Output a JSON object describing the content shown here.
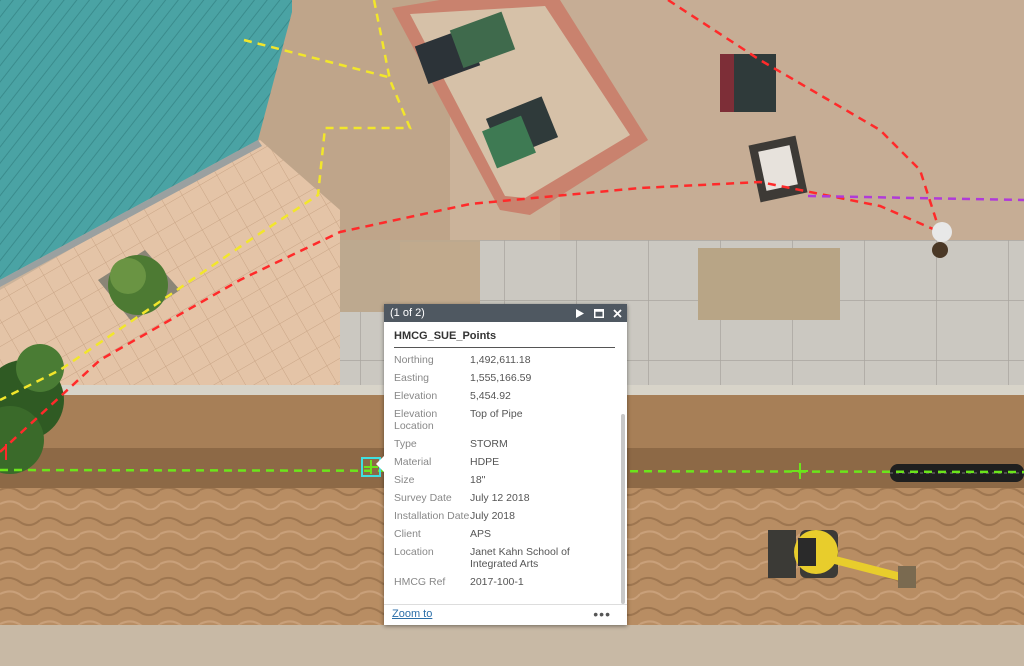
{
  "map": {
    "colors": {
      "roof": "#4aa3a4",
      "soil": "#b48a62",
      "sidewalk": "#c9c5bd",
      "tile_plaza": "#e3c2a4",
      "utility_red": "#ff2a2a",
      "utility_yellow": "#f2e62b",
      "utility_green": "#6be51b",
      "utility_purple": "#b03bd8"
    },
    "icons": [
      "excavator-icon",
      "dumpster-icon",
      "selected-point-marker",
      "survey-point-marker"
    ]
  },
  "popup": {
    "counter": "(1 of 2)",
    "title": "HMCG_SUE_Points",
    "attributes": [
      {
        "key": "Northing",
        "value": "1,492,611.18"
      },
      {
        "key": "Easting",
        "value": "1,555,166.59"
      },
      {
        "key": "Elevation",
        "value": "5,454.92"
      },
      {
        "key": "Elevation Location",
        "value": "Top of Pipe"
      },
      {
        "key": "Type",
        "value": "STORM"
      },
      {
        "key": "Material",
        "value": "HDPE"
      },
      {
        "key": "Size",
        "value": "18\""
      },
      {
        "key": "Survey Date",
        "value": "July 12 2018"
      },
      {
        "key": "Installation Date",
        "value": "July 2018"
      },
      {
        "key": "Client",
        "value": "APS"
      },
      {
        "key": "Location",
        "value": "Janet Kahn School of Integrated Arts"
      },
      {
        "key": "HMCG Ref",
        "value": "2017-100-1"
      }
    ],
    "zoom_label": "Zoom to",
    "more_label": "•••"
  }
}
